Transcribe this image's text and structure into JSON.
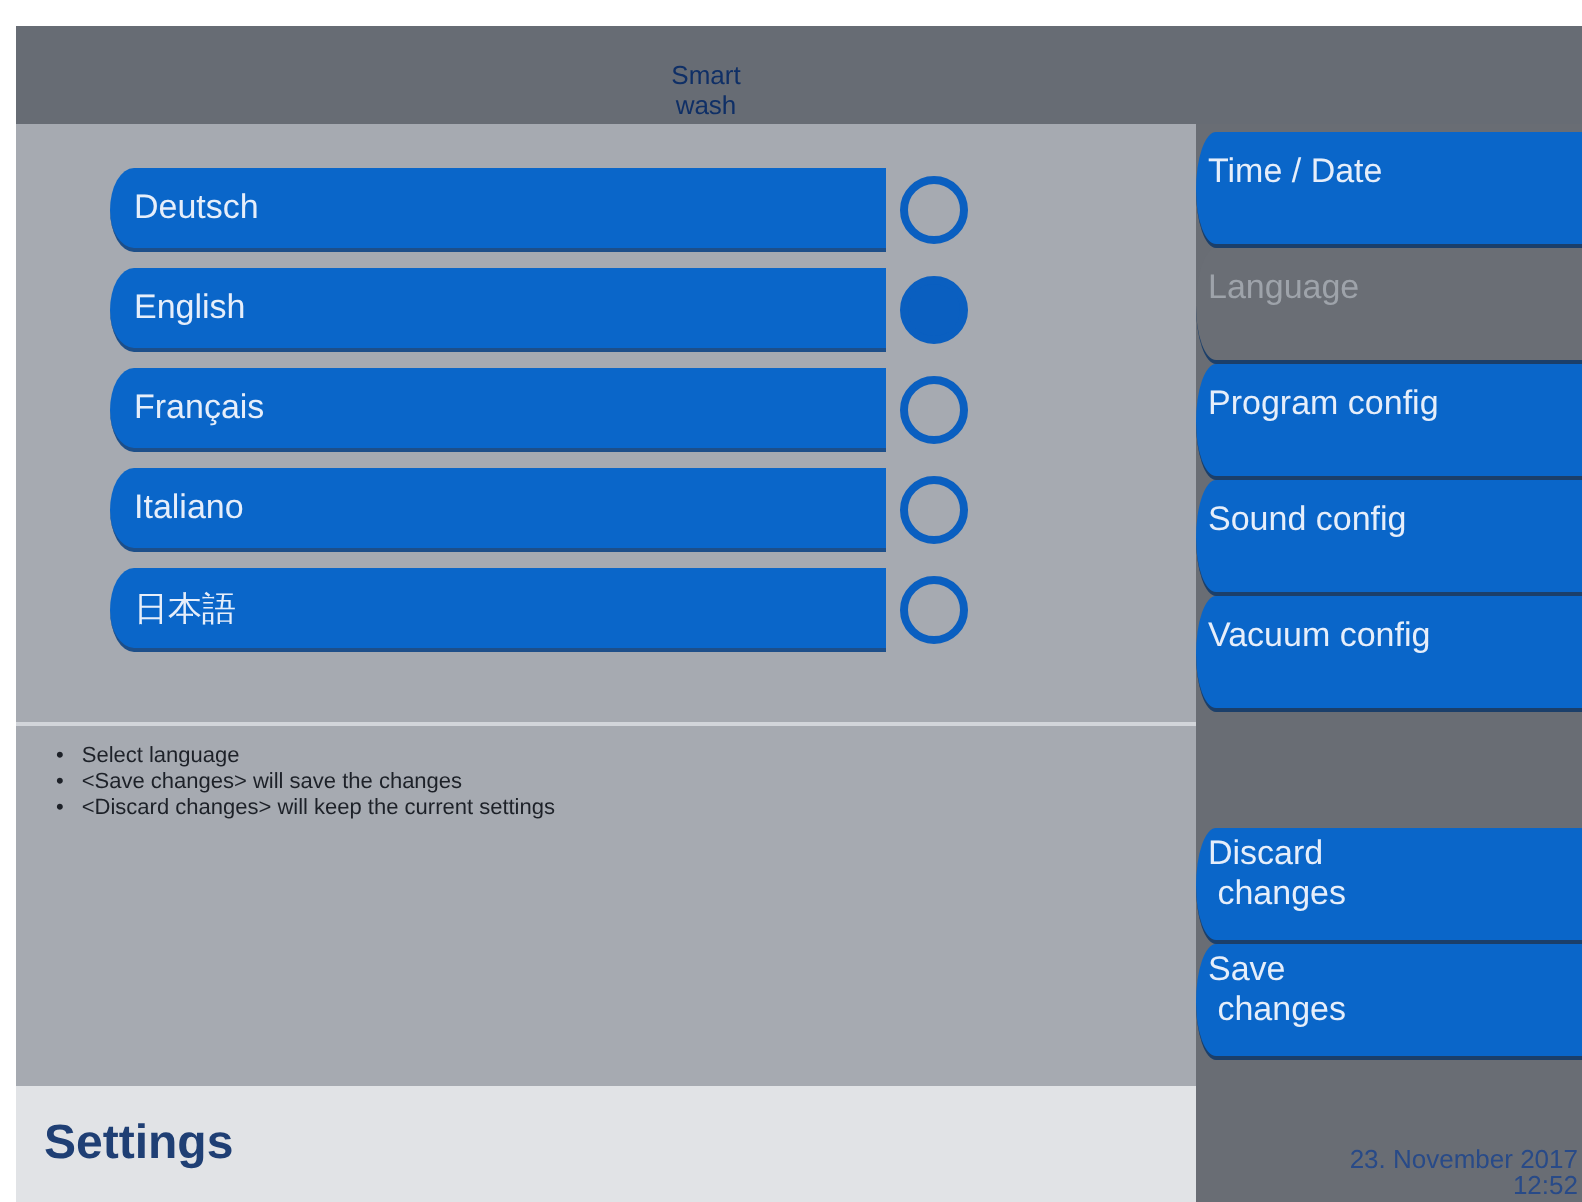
{
  "header": {
    "title": "Smart wash"
  },
  "languages": [
    {
      "label": "Deutsch",
      "selected": false
    },
    {
      "label": "English",
      "selected": true
    },
    {
      "label": "Français",
      "selected": false
    },
    {
      "label": "Italiano",
      "selected": false
    },
    {
      "label": "日本語",
      "selected": false
    }
  ],
  "hints": [
    {
      "bullet": "•",
      "text": "Select language"
    },
    {
      "bullet": "•",
      "text": "<Save changes> will save the changes"
    },
    {
      "bullet": "•",
      "text": "<Discard changes> will keep the current settings"
    }
  ],
  "menu": [
    {
      "label": "Time / Date",
      "selected": false
    },
    {
      "label": "Language",
      "selected": true
    },
    {
      "label": "Program config",
      "selected": false
    },
    {
      "label": "Sound config",
      "selected": false
    },
    {
      "label": "Vacuum config",
      "selected": false
    }
  ],
  "actions": [
    {
      "label": "Discard\n changes"
    },
    {
      "label": "Save\n changes"
    }
  ],
  "footer": {
    "title": "Settings",
    "date": "23. November 2017",
    "time": "12:52"
  }
}
